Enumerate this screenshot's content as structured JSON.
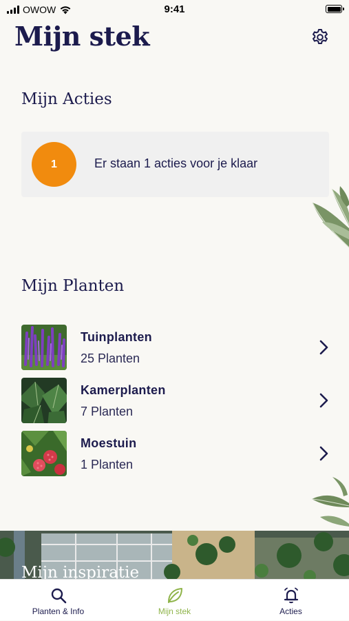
{
  "status_bar": {
    "carrier": "OWOW",
    "time": "9:41",
    "battery_level": 1.0
  },
  "page": {
    "title": "Mijn stek",
    "settings_icon": "gear-icon"
  },
  "actions_section": {
    "title": "Mijn Acties",
    "card": {
      "count": "1",
      "message": "Er staan 1 acties voor je klaar"
    }
  },
  "plants_section": {
    "title": "Mijn Planten",
    "items": [
      {
        "name": "Tuinplanten",
        "count": "25 Planten",
        "thumb": "salvia-photo"
      },
      {
        "name": "Kamerplanten",
        "count": "7 Planten",
        "thumb": "ivy-photo"
      },
      {
        "name": "Moestuin",
        "count": "1 Planten",
        "thumb": "raspberry-photo"
      }
    ]
  },
  "inspiration": {
    "title": "Mijn inspiratie"
  },
  "tab_bar": {
    "active": "Mijn stek",
    "tabs": [
      {
        "label": "Planten & Info",
        "icon": "search-icon"
      },
      {
        "label": "Mijn stek",
        "icon": "leaf-icon"
      },
      {
        "label": "Acties",
        "icon": "bell-icon"
      }
    ]
  },
  "colors": {
    "background": "#f9f8f4",
    "navy": "#1c1b4d",
    "badge_orange": "#f18b0e",
    "active_green": "#8fb44a",
    "card_grey": "#f0f0f0"
  }
}
